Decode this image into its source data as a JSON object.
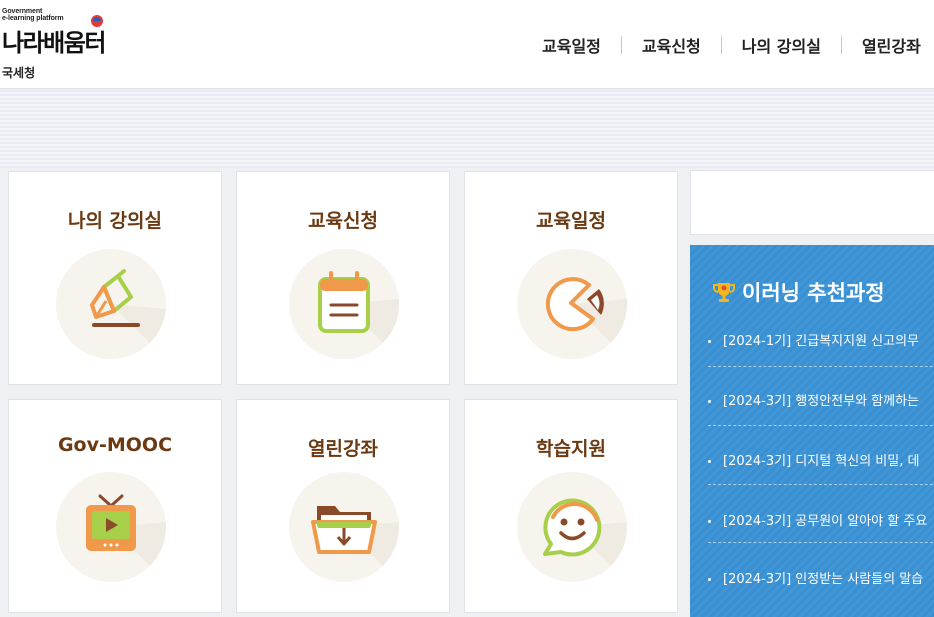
{
  "header": {
    "logo_small": "Government\ne-learning platform",
    "logo_main": "나라배움터",
    "org": "국세청",
    "nav": [
      "교육일정",
      "교육신청",
      "나의 강의실",
      "열린강좌"
    ]
  },
  "tiles": [
    {
      "title": "나의 강의실",
      "icon": "pen-icon"
    },
    {
      "title": "교육신청",
      "icon": "calendar-icon"
    },
    {
      "title": "교육일정",
      "icon": "pie-chart-icon"
    },
    {
      "title": "Gov-MOOC",
      "icon": "tv-icon"
    },
    {
      "title": "열린강좌",
      "icon": "folder-download-icon"
    },
    {
      "title": "학습지원",
      "icon": "smile-chat-icon"
    }
  ],
  "reco": {
    "icon": "trophy-icon",
    "title": "이러닝 추천과정",
    "items": [
      "[2024-1기] 긴급복지지원 신고의무",
      "[2024-3기] 행정안전부와 함께하는",
      "[2024-3기] 디지털 혁신의 비밀, 데",
      "[2024-3기] 공무원이 알아야 할 주요",
      "[2024-3기] 인정받는 사람들의 말습"
    ]
  },
  "colors": {
    "tile_title": "#6b3a12",
    "reco_bg": "#3a8fd0",
    "icon_orange": "#f0994a",
    "icon_green": "#a8cf4a",
    "icon_brown": "#8a4a2a"
  }
}
